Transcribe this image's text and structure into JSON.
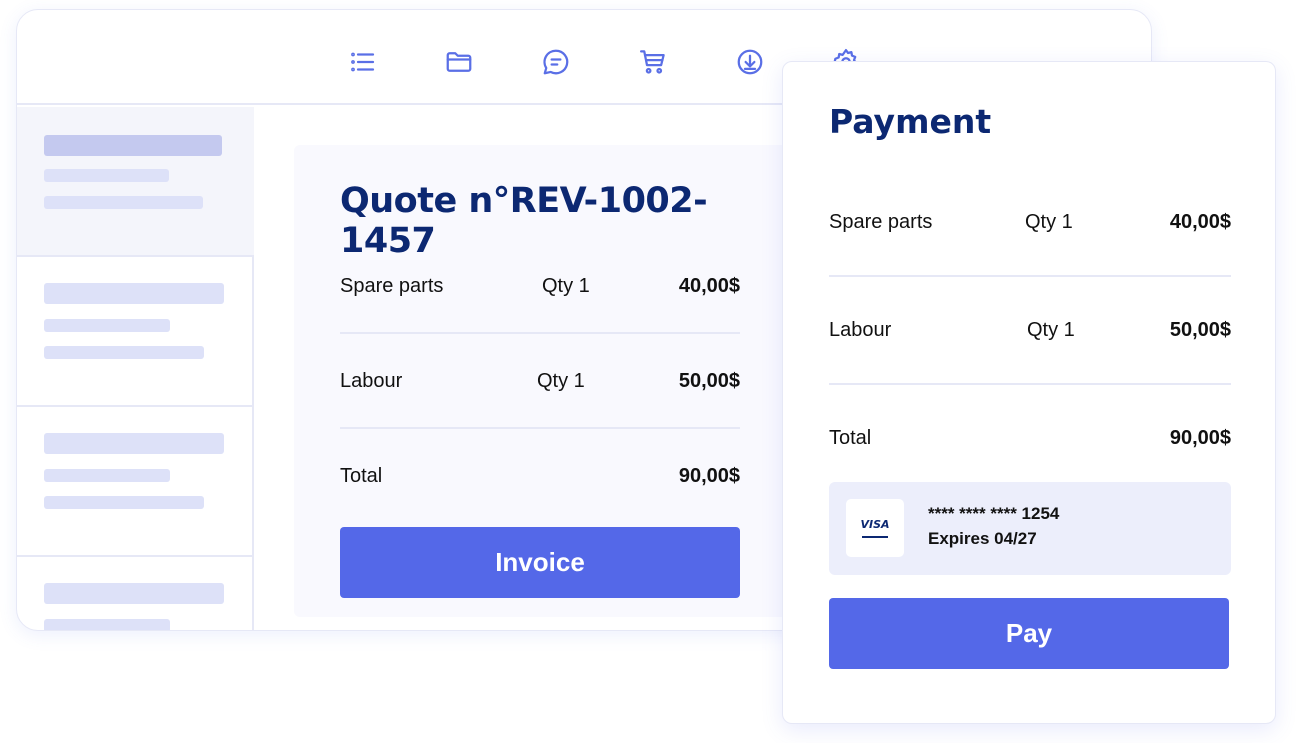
{
  "toolbar": {
    "icons": [
      "list-icon",
      "folder-icon",
      "chat-icon",
      "cart-icon",
      "download-icon",
      "gear-icon"
    ]
  },
  "colors": {
    "accent": "#5468e8",
    "title": "#0c2872",
    "skeleton": "#dde1f8",
    "skeleton_active": "#c4c9ef",
    "divider": "#e6e8f6",
    "card_bg": "#eceefb"
  },
  "quote": {
    "title": "Quote n°REV-1002-1457",
    "rows": [
      {
        "label": "Spare parts",
        "qty": "Qty 1",
        "amount": "40,00$"
      },
      {
        "label": "Labour",
        "qty": "Qty 1",
        "amount": "50,00$"
      }
    ],
    "total_label": "Total",
    "total_amount": "90,00$",
    "invoice_button": "Invoice"
  },
  "payment": {
    "title": "Payment",
    "rows": [
      {
        "label": "Spare parts",
        "qty": "Qty 1",
        "amount": "40,00$"
      },
      {
        "label": "Labour",
        "qty": "Qty 1",
        "amount": "50,00$"
      }
    ],
    "total_label": "Total",
    "total_amount": "90,00$",
    "card": {
      "brand": "VISA",
      "number": "**** **** **** 1254",
      "expiry": "Expires 04/27"
    },
    "pay_button": "Pay"
  }
}
